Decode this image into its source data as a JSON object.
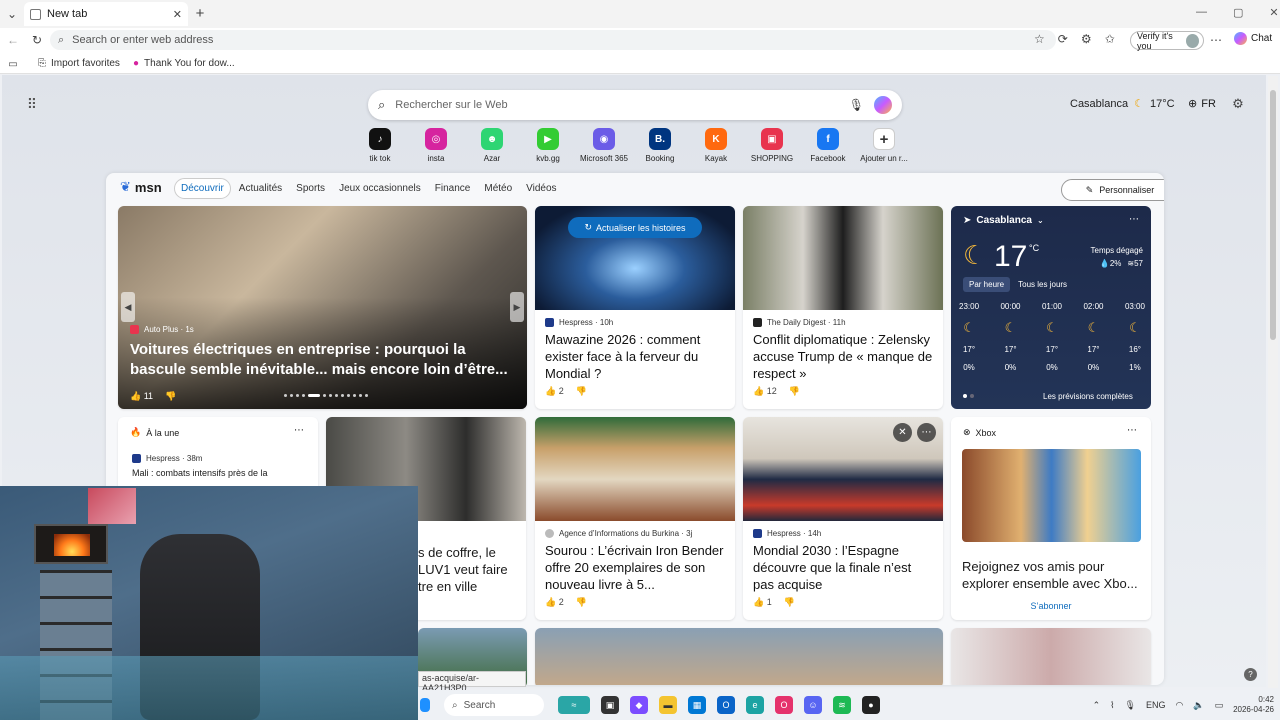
{
  "browser": {
    "tab_title": "New tab",
    "address_placeholder": "Search or enter web address",
    "verify_label": "Verify it's you",
    "chat_label": "Chat",
    "favorites": [
      "Import favorites",
      "Thank You for dow..."
    ]
  },
  "newtab": {
    "search_placeholder": "Rechercher sur le Web",
    "location": "Casablanca",
    "temperature": "17°C",
    "language": "FR",
    "shortcuts": [
      {
        "label": "tik tok",
        "color": "#111111",
        "glyph": "♪"
      },
      {
        "label": "insta",
        "color": "#d6249f",
        "glyph": "◎"
      },
      {
        "label": "Azar",
        "color": "#2ed573",
        "glyph": "☻"
      },
      {
        "label": "kvb.gg",
        "color": "#33cc33",
        "glyph": "▶"
      },
      {
        "label": "Microsoft 365",
        "color": "#6b5ce7",
        "glyph": "◉"
      },
      {
        "label": "Booking",
        "color": "#003580",
        "glyph": "B."
      },
      {
        "label": "Kayak",
        "color": "#ff690f",
        "glyph": "K"
      },
      {
        "label": "SHOPPING",
        "color": "#e8344e",
        "glyph": "▣"
      },
      {
        "label": "Facebook",
        "color": "#1877f2",
        "glyph": "f"
      },
      {
        "label": "Ajouter un r...",
        "color": "#ffffff",
        "glyph": "+"
      }
    ]
  },
  "msn": {
    "logo": "msn",
    "tabs": [
      "Découvrir",
      "Actualités",
      "Sports",
      "Jeux occasionnels",
      "Finance",
      "Météo",
      "Vidéos"
    ],
    "personalize": "Personnaliser",
    "hero": {
      "source": "Auto Plus · 1s",
      "headline": "Voitures électriques en entreprise : pourquoi la bascule semble inévitable... mais encore loin d’être...",
      "likes": "11"
    },
    "refresh_button": "Actualiser les histoires",
    "cards_top": [
      {
        "source": "Hespress · 10h",
        "headline": "Mawazine 2026 : comment exister face à la ferveur du Mondial ?",
        "likes": "2"
      },
      {
        "source": "The Daily Digest · 11h",
        "headline": "Conflit diplomatique : Zelensky accuse Trump de « manque de respect »",
        "likes": "12"
      }
    ],
    "weather": {
      "city": "Casablanca",
      "temp": "17",
      "unit": "°C",
      "condition": "Temps dégagé",
      "precip": "2%",
      "humidity": "57",
      "toggle": [
        "Par heure",
        "Tous les jours"
      ],
      "hours": [
        {
          "time": "23:00",
          "temp": "17°",
          "rain": "0%"
        },
        {
          "time": "00:00",
          "temp": "17°",
          "rain": "0%"
        },
        {
          "time": "01:00",
          "temp": "17°",
          "rain": "0%"
        },
        {
          "time": "02:00",
          "temp": "17°",
          "rain": "0%"
        },
        {
          "time": "03:00",
          "temp": "16°",
          "rain": "1%"
        }
      ],
      "full_forecast": "Les prévisions complètes"
    },
    "a_la_une": {
      "title": "À la une",
      "source": "Hespress · 38m",
      "headline": "Mali : combats intensifs près de la"
    },
    "card_partial": {
      "headline_lines": [
        "s de coffre, le",
        "LUV1 veut faire",
        "tre en ville"
      ]
    },
    "cards_mid": [
      {
        "source": "Agence d’Informations du Burkina · 3j",
        "headline": "Sourou : L’écrivain Iron Bender offre 20 exemplaires de son nouveau livre à 5...",
        "likes": "2"
      },
      {
        "source": "Hespress · 14h",
        "headline": "Mondial 2030 : l’Espagne découvre que la finale n’est pas acquise",
        "likes": "1"
      }
    ],
    "xbox": {
      "title": "Xbox",
      "headline": "Rejoignez vos amis pour explorer ensemble avec Xbo...",
      "cta": "S’abonner"
    },
    "url_fragment": "as-acquise/ar-AA21H3P0"
  },
  "taskbar": {
    "search": "Search",
    "lang": "ENG",
    "time": "0:42",
    "date": "2026-04-26"
  }
}
